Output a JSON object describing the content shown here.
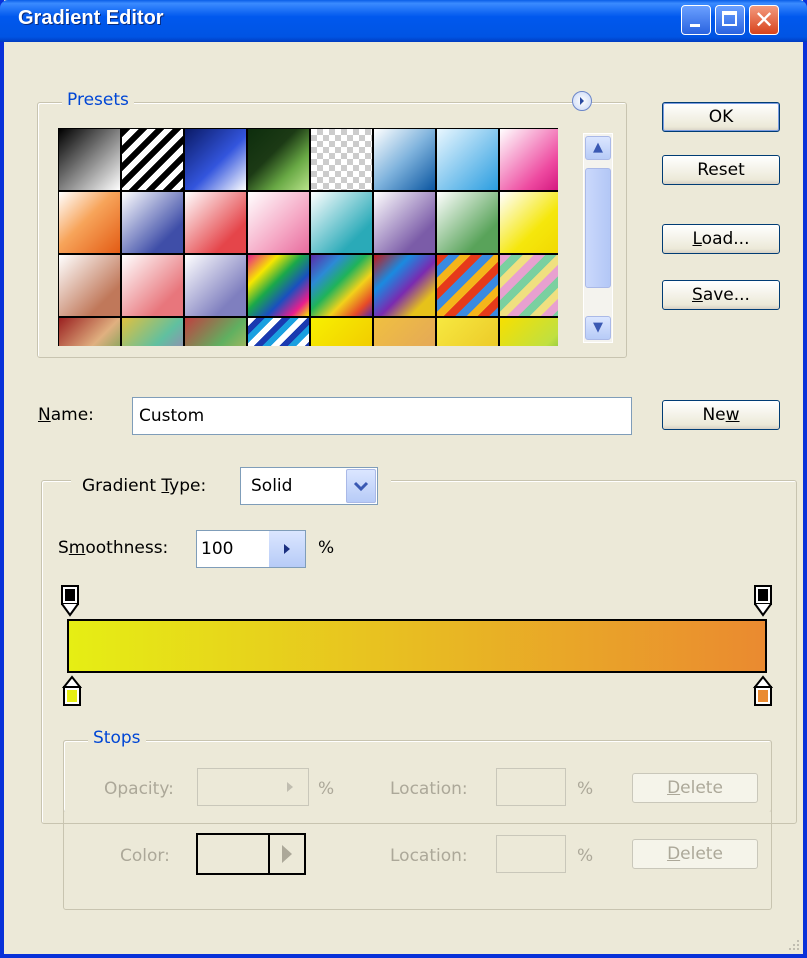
{
  "window": {
    "title": "Gradient Editor"
  },
  "presets": {
    "legend": "Presets",
    "swatches": [
      "linear-gradient(135deg,#000 0%,#fff 100%)",
      "repeating-linear-gradient(135deg,#000 0 6px,#fff 6px 12px)",
      "linear-gradient(135deg,#0a1a66,#3355dd 55%,#ffffff)",
      "linear-gradient(135deg,#0d2d0d,#1c3a15 40%,#69a945 70%,#b8e38a)",
      "repeating-conic-gradient(#ccc 0 25%,#fff 0 50%) 0 0/12px 12px",
      "linear-gradient(135deg,#ffffff,#7fb3dd 50%,#0a55a0)",
      "linear-gradient(135deg,#e9f7ff,#2a9de0)",
      "linear-gradient(135deg,#ffffff,#ee4aa0 70%,#d2147d)",
      "linear-gradient(135deg,#ffffff,#f7a45a 45%,#e35b14)",
      "linear-gradient(135deg,#ffffff,#3f4ea8 75%)",
      "linear-gradient(135deg,#ffffff,#e5454a 75%)",
      "linear-gradient(135deg,#ffffff,#f5a8c5 60%,#e86c9e)",
      "linear-gradient(135deg,#ffffff,#2aaab8 75%)",
      "linear-gradient(135deg,#ffffff,#7b5ca8 75%)",
      "linear-gradient(135deg,#ffffff,#59a35a 75%)",
      "linear-gradient(135deg,#ffffff,#f5e70c 60%,#f1d800)",
      "linear-gradient(135deg,#ffffff,#c0785a 75%)",
      "linear-gradient(135deg,#ffffff,#e8767c 75%)",
      "linear-gradient(135deg,#ffffff,#7f7fbf 75%)",
      "linear-gradient(135deg,#e91e8c,#f7e600 25%,#1aa84a 45%,#1a4fbf 65%,#e91e8c 85%,#f7e600)",
      "linear-gradient(135deg,#5b2aa8,#2c8ad6 25%,#1fb35a 45%,#f2d21a 65%,#e64a28 85%,#5b2aa8)",
      "linear-gradient(135deg,#c21a1a,#1a8ae0 30%,#7a2ab0 55%,#e6c21a 80%)",
      "repeating-linear-gradient(135deg,#e63a1a 0 8px,#3a8ae0 8px 16px,#f5b51a 16px 24px)",
      "repeating-linear-gradient(135deg,#e8a0d0 0 8px,#7ad0a0 8px 16px,#f0e080 16px 24px)",
      "linear-gradient(135deg,#9a2020,#e0b080 50%,#3a9a3a)",
      "linear-gradient(135deg,#e0c040,#60c0a0 50%,#c060c0)",
      "linear-gradient(135deg,#c04040,#60b060 50%,#e0c060)",
      "repeating-linear-gradient(135deg,#ffffff 0 6px,#1a3ab0 6px 12px,#1aa0e0 12px 18px)",
      "linear-gradient(135deg,#f7f000,#f0c000)",
      "linear-gradient(135deg,#f0c040,#e0a060)",
      "linear-gradient(135deg,#f7e840,#e8c020)",
      "linear-gradient(135deg,#f7e000,#c0e040 60%,#40a040)"
    ]
  },
  "buttons": {
    "ok": "OK",
    "reset": "Reset",
    "load": "Load...",
    "save": "Save...",
    "new": "New"
  },
  "name": {
    "label": "Name:",
    "value": "Custom"
  },
  "gradient_type": {
    "label": "Gradient Type:",
    "value": "Solid"
  },
  "smoothness": {
    "label": "Smoothness:",
    "value": "100",
    "unit": "%"
  },
  "gradient": {
    "start_color": "#e6ee14",
    "end_color": "#ea8a30",
    "opacity_stop_color": "#000000"
  },
  "stops": {
    "legend": "Stops",
    "opacity_label": "Opacity:",
    "percent": "%",
    "location_label": "Location:",
    "delete_label": "Delete",
    "color_label": "Color:"
  }
}
